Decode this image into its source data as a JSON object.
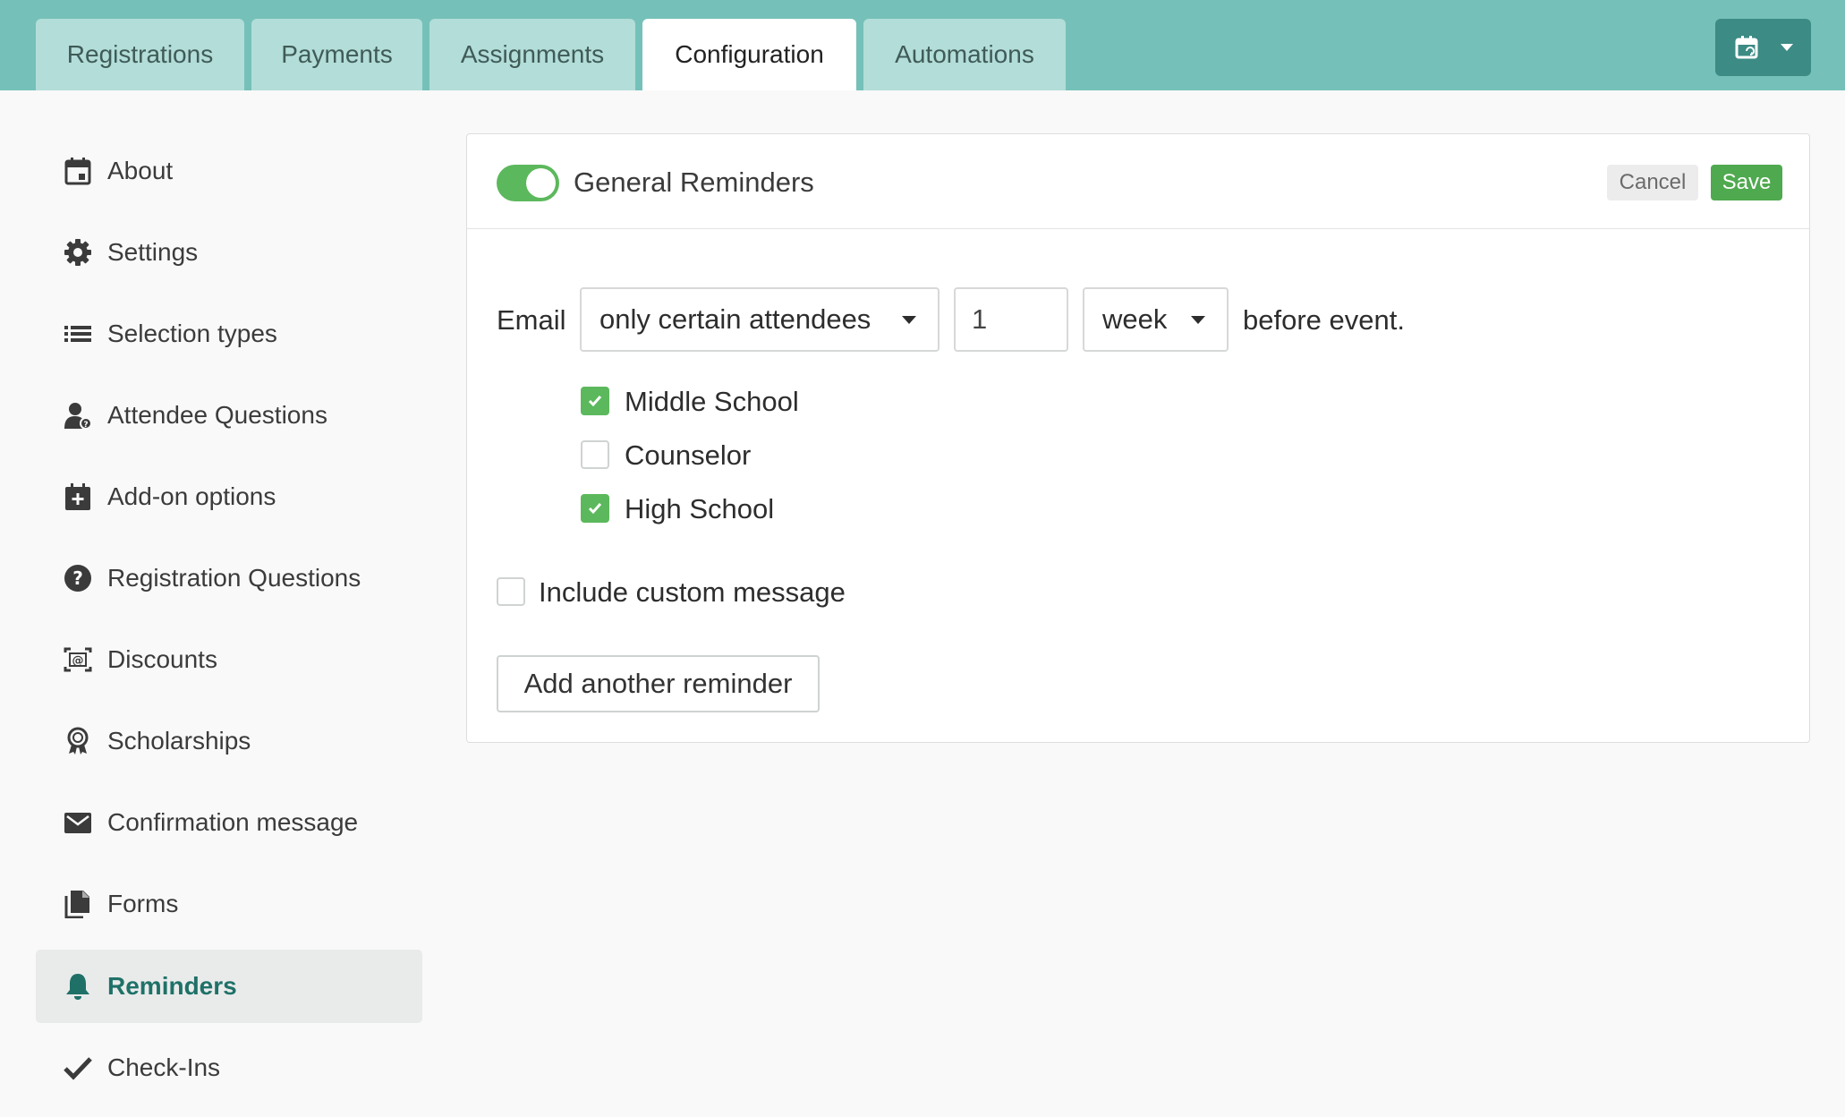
{
  "tabs": [
    {
      "label": "Registrations",
      "active": false
    },
    {
      "label": "Payments",
      "active": false
    },
    {
      "label": "Assignments",
      "active": false
    },
    {
      "label": "Configuration",
      "active": true
    },
    {
      "label": "Automations",
      "active": false
    }
  ],
  "header_button": {
    "icon": "calendar-sync-icon",
    "caret_icon": "caret-down-icon"
  },
  "sidebar": {
    "items": [
      {
        "label": "About",
        "icon": "calendar-icon"
      },
      {
        "label": "Settings",
        "icon": "gear-icon"
      },
      {
        "label": "Selection types",
        "icon": "list-icon"
      },
      {
        "label": "Attendee Questions",
        "icon": "user-question-icon"
      },
      {
        "label": "Add-on options",
        "icon": "calendar-plus-icon"
      },
      {
        "label": "Registration Questions",
        "icon": "question-circle-icon"
      },
      {
        "label": "Discounts",
        "icon": "discount-icon"
      },
      {
        "label": "Scholarships",
        "icon": "award-icon"
      },
      {
        "label": "Confirmation message",
        "icon": "envelope-icon"
      },
      {
        "label": "Forms",
        "icon": "documents-icon"
      },
      {
        "label": "Reminders",
        "icon": "bell-icon",
        "active": true
      },
      {
        "label": "Check-Ins",
        "icon": "checkmark-icon"
      }
    ]
  },
  "reminder": {
    "enabled": true,
    "title": "General Reminders",
    "cancel_label": "Cancel",
    "save_label": "Save",
    "email_label": "Email",
    "audience_value": "only certain attendees",
    "amount_value": "1",
    "unit_value": "week",
    "suffix_text": "before event.",
    "attendee_types": [
      {
        "label": "Middle School",
        "checked": true
      },
      {
        "label": "Counselor",
        "checked": false
      },
      {
        "label": "High School",
        "checked": true
      }
    ],
    "custom_message_label": "Include custom message",
    "custom_message_checked": false,
    "add_button_label": "Add another reminder"
  },
  "colors": {
    "topbar": "#75c1b9",
    "tab_inactive": "#b3ddd8",
    "header_button": "#3c8b84",
    "toggle_on": "#5cb85c",
    "save_button": "#4fa94f",
    "active_sidebar_text": "#1f7168"
  }
}
